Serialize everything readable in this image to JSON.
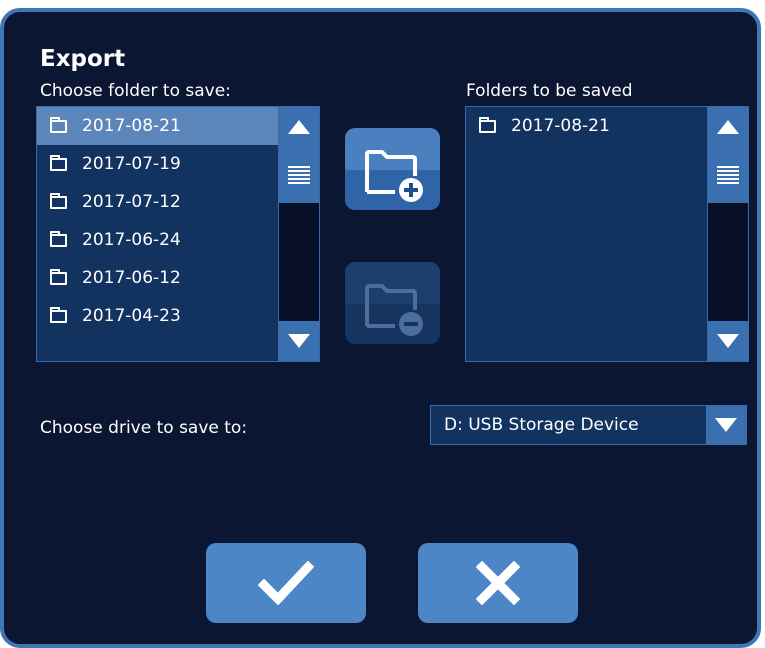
{
  "dialog": {
    "title": "Export"
  },
  "source": {
    "label": "Choose folder to save:",
    "folders": [
      "2017-08-21",
      "2017-07-19",
      "2017-07-12",
      "2017-06-24",
      "2017-06-12",
      "2017-04-23"
    ],
    "selected_index": 0
  },
  "target": {
    "label": "Folders to be saved",
    "folders": [
      "2017-08-21"
    ]
  },
  "drive": {
    "label": "Choose drive to save to:",
    "value": "D: USB Storage Device"
  },
  "icons": {
    "add": "folder-add-icon",
    "remove": "folder-remove-icon",
    "ok": "checkmark-icon",
    "cancel": "close-icon",
    "folder": "folder-icon"
  },
  "colors": {
    "background": "#0b1633",
    "border": "#3e76b6",
    "accent": "#3a6fb0",
    "selected_row": "#5c86b9",
    "button": "#4d86c6"
  }
}
